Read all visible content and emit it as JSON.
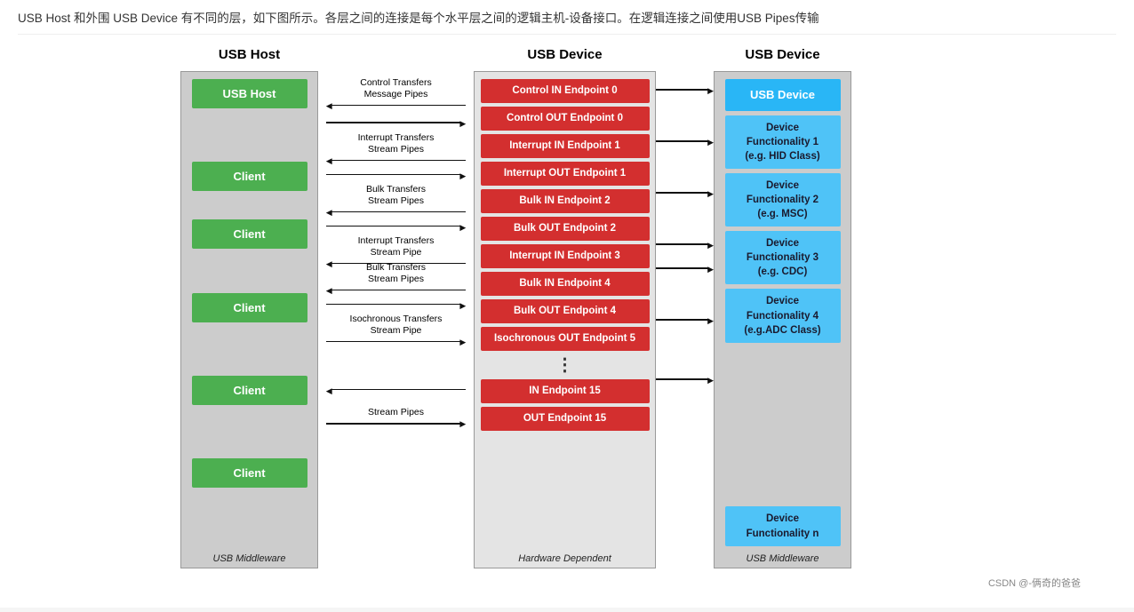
{
  "intro": {
    "text": "USB Host 和外围 USB Device 有不同的层，如下图所示。各层之间的连接是每个水平层之间的逻辑主机-设备接口。在逻辑连接之间使用USB Pipes传输"
  },
  "diagram": {
    "host_title": "USB Host",
    "device_title": "USB Device",
    "host_panel": {
      "label": "USB Middleware",
      "boxes": [
        "USB Host",
        "Client",
        "Client",
        "Client",
        "Client",
        "Client"
      ]
    },
    "endpoints_panel": {
      "label": "Hardware Dependent",
      "endpoints": [
        "Control IN Endpoint 0",
        "Control OUT Endpoint 0",
        "Interrupt IN Endpoint 1",
        "Interrupt OUT Endpoint 1",
        "Bulk IN Endpoint 2",
        "Bulk OUT Endpoint 2",
        "Interrupt IN Endpoint 3",
        "Bulk IN Endpoint 4",
        "Bulk OUT Endpoint 4",
        "Isochronous OUT Endpoint 5",
        "IN Endpoint 15",
        "OUT Endpoint 15"
      ],
      "dots": "⋮"
    },
    "device_panel": {
      "label": "USB Middleware",
      "boxes": [
        {
          "text": "USB Device",
          "type": "blue"
        },
        {
          "text": "Device\nFunctionality 1\n(e.g. HID Class)",
          "type": "cyan"
        },
        {
          "text": "Device\nFunctionality 2\n(e.g. MSC)",
          "type": "cyan"
        },
        {
          "text": "Device\nFunctionality 3\n(e.g. CDC)",
          "type": "cyan"
        },
        {
          "text": "Device\nFunctionality 4\n(e.g.ADC Class)",
          "type": "cyan"
        },
        {
          "text": "Device\nFunctionality n",
          "type": "cyan"
        }
      ]
    },
    "arrows": [
      {
        "label": "Control Transfers\nMessage Pipes",
        "direction": "left"
      },
      {
        "label": "",
        "direction": "right"
      },
      {
        "label": "Interrupt Transfers\nStream Pipes",
        "direction": "left"
      },
      {
        "label": "",
        "direction": "right"
      },
      {
        "label": "Bulk Transfers\nStream Pipes",
        "direction": "left"
      },
      {
        "label": "",
        "direction": "right"
      },
      {
        "label": "Interrupt Transfers\nStream Pipe",
        "direction": "left"
      },
      {
        "label": "Bulk Transfers\nStream Pipes",
        "direction": "left"
      },
      {
        "label": "",
        "direction": "right"
      },
      {
        "label": "Isochronous Transfers\nStream Pipe",
        "direction": "right"
      },
      {
        "label": "",
        "direction": "left"
      },
      {
        "label": "Stream Pipes",
        "direction": "right"
      }
    ]
  },
  "watermark": {
    "text": "CSDN @-俩奇的爸爸"
  }
}
